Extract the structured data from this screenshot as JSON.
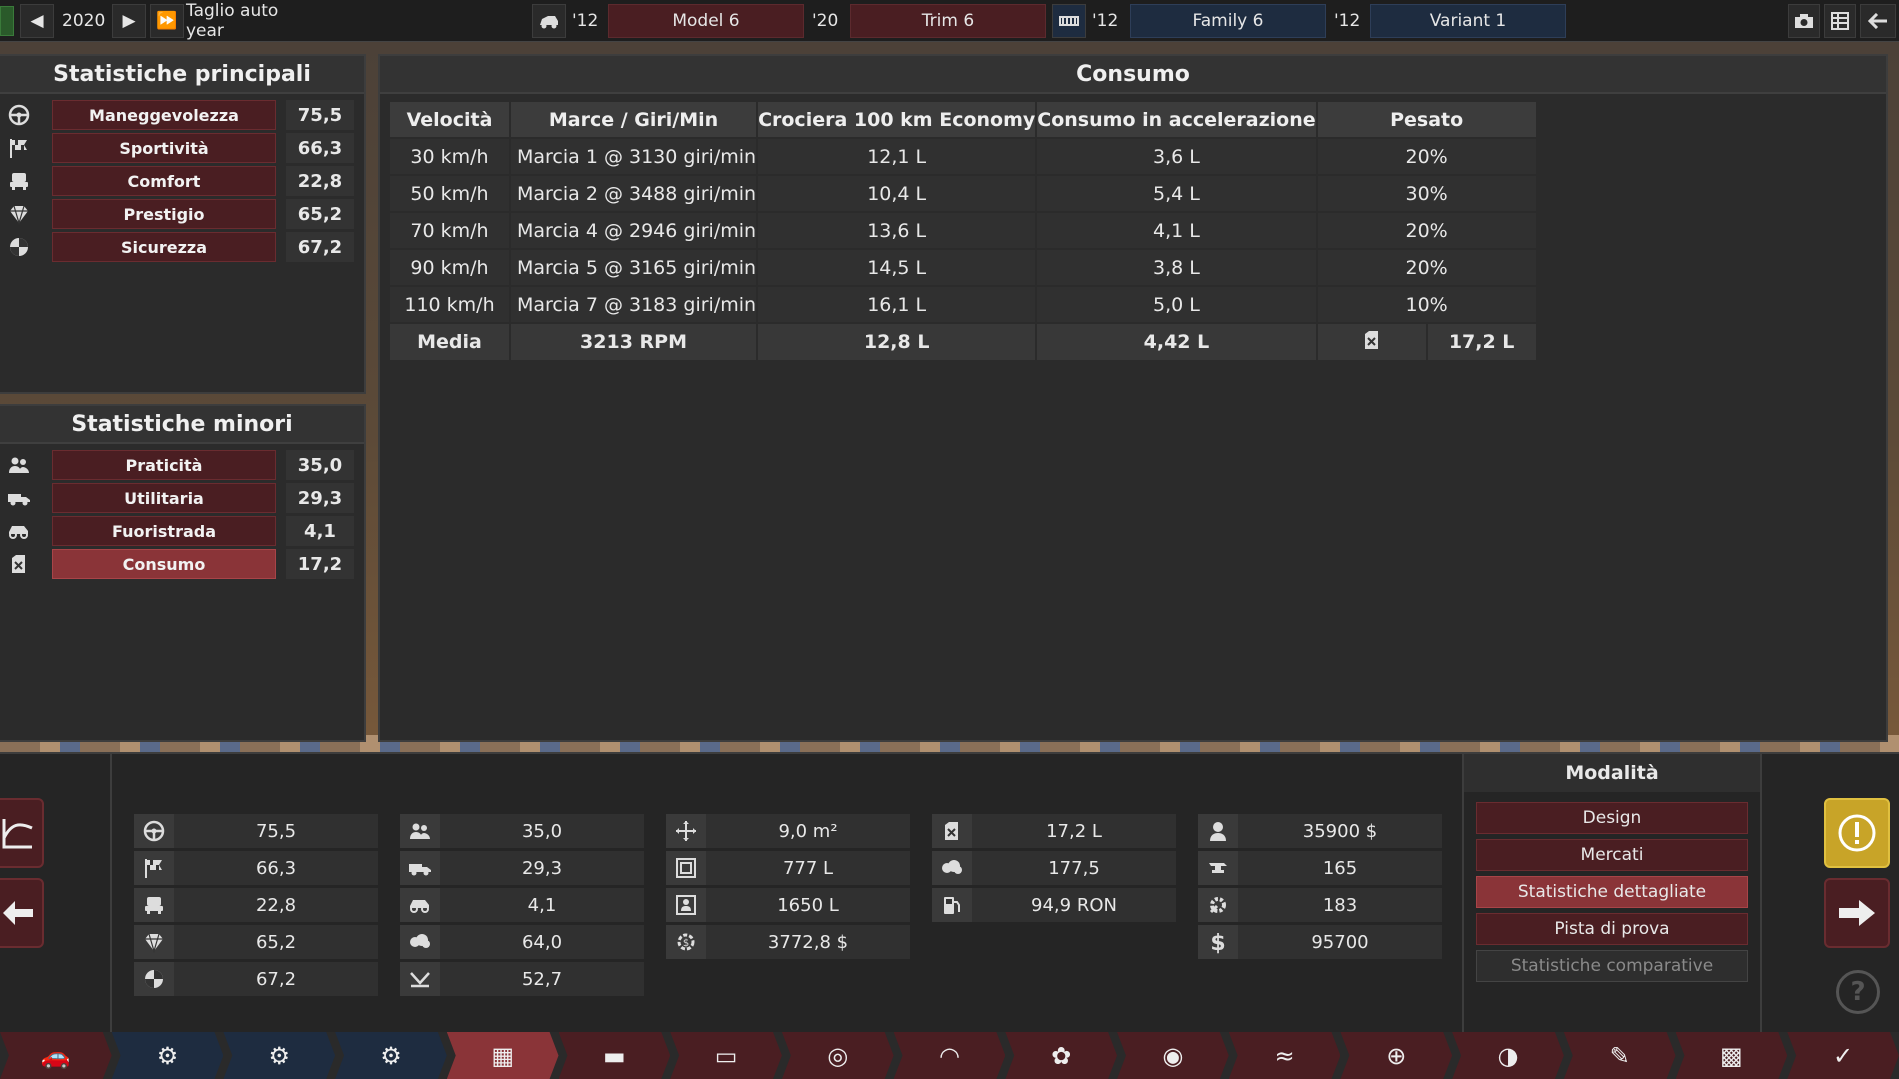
{
  "topbar": {
    "year": "2020",
    "chassis_label": "Taglio auto year",
    "model_year": "'12",
    "model": "Model 6",
    "trim_year": "'20",
    "trim": "Trim 6",
    "family_year": "'12",
    "family": "Family 6",
    "variant_year": "'12",
    "variant": "Variant 1"
  },
  "main_stats": {
    "title": "Statistiche principali",
    "items": [
      {
        "label": "Maneggevolezza",
        "value": "75,5",
        "icon": "steering-wheel-icon"
      },
      {
        "label": "Sportività",
        "value": "66,3",
        "icon": "checkered-flag-icon"
      },
      {
        "label": "Comfort",
        "value": "22,8",
        "icon": "seat-icon"
      },
      {
        "label": "Prestigio",
        "value": "65,2",
        "icon": "diamond-icon"
      },
      {
        "label": "Sicurezza",
        "value": "67,2",
        "icon": "crash-test-icon"
      }
    ]
  },
  "minor_stats": {
    "title": "Statistiche minori",
    "items": [
      {
        "label": "Praticità",
        "value": "35,0",
        "icon": "people-icon"
      },
      {
        "label": "Utilitaria",
        "value": "29,3",
        "icon": "truck-icon"
      },
      {
        "label": "Fuoristrada",
        "value": "4,1",
        "icon": "offroad-icon"
      },
      {
        "label": "Consumo",
        "value": "17,2",
        "icon": "fuel-can-icon",
        "active": true
      }
    ]
  },
  "consumption": {
    "title": "Consumo",
    "headers": [
      "Velocità",
      "Marce / Giri/Min",
      "Crociera 100 km Economy",
      "Consumo in accelerazione",
      "Pesato"
    ],
    "rows": [
      [
        "30 km/h",
        "Marcia 1 @ 3130 giri/min",
        "12,1 L",
        "3,6 L",
        "20%"
      ],
      [
        "50 km/h",
        "Marcia 2 @ 3488 giri/min",
        "10,4 L",
        "5,4 L",
        "30%"
      ],
      [
        "70 km/h",
        "Marcia 4 @ 2946 giri/min",
        "13,6 L",
        "4,1 L",
        "20%"
      ],
      [
        "90 km/h",
        "Marcia 5 @ 3165 giri/min",
        "14,5 L",
        "3,8 L",
        "20%"
      ],
      [
        "110 km/h",
        "Marcia 7 @ 3183 giri/min",
        "16,1 L",
        "5,0 L",
        "10%"
      ]
    ],
    "avg": {
      "label": "Media",
      "rpm": "3213 RPM",
      "cruise": "12,8 L",
      "accel": "4,42 L",
      "weighted": "17,2 L"
    }
  },
  "summary": {
    "col1": [
      "75,5",
      "66,3",
      "22,8",
      "65,2",
      "67,2"
    ],
    "col2": [
      "35,0",
      "29,3",
      "4,1",
      "64,0",
      "52,7"
    ],
    "col3": [
      "9,0 m²",
      "777 L",
      "1650 L",
      "3772,8 $"
    ],
    "col4": [
      "17,2 L",
      "177,5",
      "94,9 RON"
    ],
    "col5": [
      "35900 $",
      "165",
      "183",
      "95700"
    ]
  },
  "modes": {
    "title": "Modalità",
    "items": [
      {
        "label": "Design",
        "state": "normal"
      },
      {
        "label": "Mercati",
        "state": "normal"
      },
      {
        "label": "Statistiche dettagliate",
        "state": "active"
      },
      {
        "label": "Pista di prova",
        "state": "normal"
      },
      {
        "label": "Statistiche comparative",
        "state": "disabled"
      }
    ]
  },
  "colors": {
    "accent_red": "#4a1e22",
    "active_red": "#8a3438",
    "family_blue": "#1e2c40",
    "warning_yellow": "#c8a428"
  }
}
